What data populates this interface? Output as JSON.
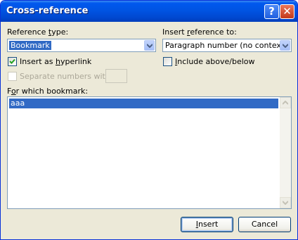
{
  "window": {
    "title": "Cross-reference",
    "help_glyph": "?",
    "close_glyph": "✕"
  },
  "reference_type": {
    "label_pre": "Reference ",
    "label_u": "t",
    "label_post": "ype:",
    "value": "Bookmark"
  },
  "insert_reference_to": {
    "label_pre": "Insert ",
    "label_u": "r",
    "label_post": "eference to:",
    "value": "Paragraph number (no context)"
  },
  "insert_as_hyperlink": {
    "label_pre": "Insert as ",
    "label_u": "h",
    "label_post": "yperlink",
    "checked": true
  },
  "include_above_below": {
    "label_u": "I",
    "label_post": "nclude above/below",
    "checked": false
  },
  "separate_numbers": {
    "label": "Separate numbers with",
    "checked": false,
    "enabled": false
  },
  "bookmark_list": {
    "label_pre": "F",
    "label_u": "o",
    "label_post": "r which bookmark:",
    "items": [
      "aaa"
    ],
    "selected": "aaa"
  },
  "buttons": {
    "insert_u": "I",
    "insert_post": "nsert",
    "cancel": "Cancel"
  },
  "colors": {
    "title_bar": "#0054e3",
    "selection": "#316ac5",
    "dialog_bg": "#ece9d8"
  }
}
